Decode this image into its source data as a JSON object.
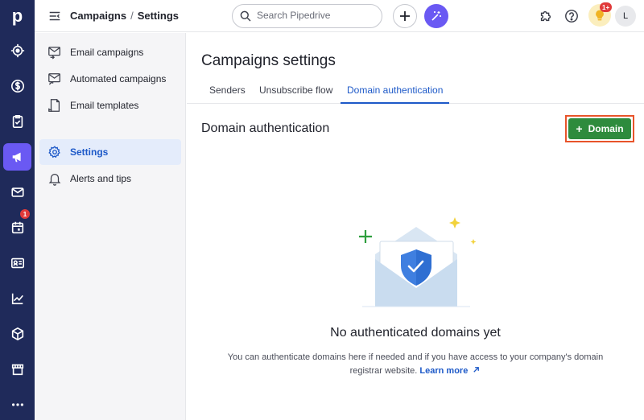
{
  "brand": {
    "logo_letter": "p",
    "accent": "#6a59f3",
    "rail_bg": "#1f2a5a",
    "link": "#1d59c8",
    "primary": "#2e8b3d"
  },
  "rail": {
    "items": [
      {
        "icon": "target-icon"
      },
      {
        "icon": "dollar-icon"
      },
      {
        "icon": "clipboard-icon"
      },
      {
        "icon": "megaphone-icon",
        "active": true
      },
      {
        "icon": "mail-icon"
      },
      {
        "icon": "calendar-icon",
        "badge": "1"
      },
      {
        "icon": "contact-card-icon"
      },
      {
        "icon": "trend-chart-icon"
      },
      {
        "icon": "box-icon"
      },
      {
        "icon": "store-icon"
      },
      {
        "icon": "more-dots-icon"
      }
    ],
    "calendar_badge": "1"
  },
  "topbar": {
    "breadcrumb_parent": "Campaigns",
    "breadcrumb_sep": "/",
    "breadcrumb_current": "Settings",
    "search_placeholder": "Search Pipedrive",
    "notifications_badge": "1+",
    "avatar_initial": "L"
  },
  "sidebar": {
    "items": [
      {
        "label": "Email campaigns",
        "icon": "email-campaign-icon"
      },
      {
        "label": "Automated campaigns",
        "icon": "automated-campaign-icon"
      },
      {
        "label": "Email templates",
        "icon": "template-icon"
      },
      {
        "label": "Settings",
        "icon": "gear-icon",
        "active": true
      },
      {
        "label": "Alerts and tips",
        "icon": "bell-icon"
      }
    ]
  },
  "main": {
    "page_title": "Campaigns settings",
    "tabs": [
      {
        "label": "Senders"
      },
      {
        "label": "Unsubscribe flow"
      },
      {
        "label": "Domain authentication",
        "active": true
      }
    ],
    "section_title": "Domain authentication",
    "add_button": {
      "plus": "+",
      "label": "Domain"
    },
    "empty_title": "No authenticated domains yet",
    "empty_desc": "You can authenticate domains here if needed and if you have access to your company's domain registrar website.",
    "learn_more": "Learn more"
  }
}
